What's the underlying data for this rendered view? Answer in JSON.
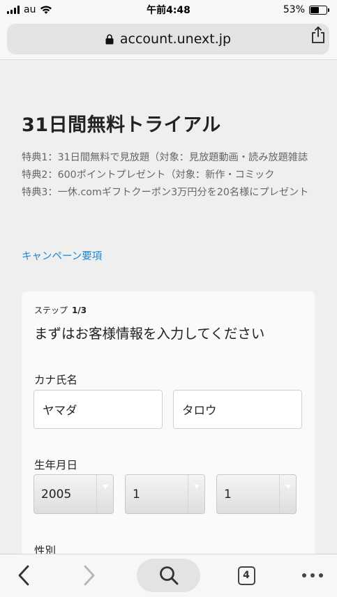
{
  "status_bar": {
    "carrier": "au",
    "time": "午前4:48",
    "battery_percent": "53%",
    "battery_level": 0.53
  },
  "browser": {
    "url": "account.unext.jp",
    "tab_count": "4"
  },
  "page": {
    "title": "31日間無料トライアル",
    "benefits": [
      "特典1：31日間無料で見放題（対象：見放題動画・読み放題雑誌",
      "特典2：600ポイントプレゼント（対象：新作・コミック",
      "特典3：一休.comギフトクーポン3万円分を20名様にプレゼント"
    ],
    "campaign_link": "キャンペーン要項"
  },
  "form": {
    "step_prefix": "ステップ",
    "step_value": "1/3",
    "step_title": "まずはお客様情報を入力してください",
    "kana_label": "カナ氏名",
    "last_name_value": "ヤマダ",
    "first_name_value": "タロウ",
    "birth_label": "生年月日",
    "birth_year": "2005",
    "birth_month": "1",
    "birth_day": "1",
    "gender_label": "性別"
  },
  "colors": {
    "link": "#1a86d6",
    "background": "#efefef"
  }
}
